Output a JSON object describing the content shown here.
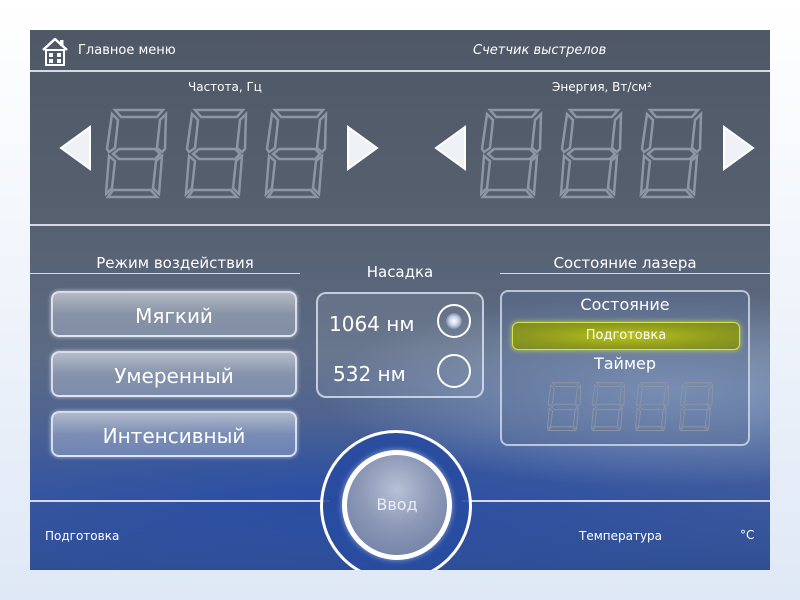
{
  "header": {
    "home_label": "Главное меню",
    "counter_label": "Счетчик выстрелов"
  },
  "frequency": {
    "label": "Частота, Гц"
  },
  "energy": {
    "label": "Энергия, Вт/см²"
  },
  "mode": {
    "title": "Режим воздействия",
    "buttons": [
      "Мягкий",
      "Умеренный",
      "Интенсивный"
    ]
  },
  "nozzle": {
    "title": "Насадка",
    "options": [
      "1064 нм",
      "532 нм"
    ],
    "selected": "1064 нм"
  },
  "laser": {
    "title": "Состояние лазера",
    "state_label": "Состояние",
    "state_value": "Подготовка",
    "state_color": "#b8c21a",
    "timer_label": "Таймер"
  },
  "enter_label": "Ввод",
  "footer": {
    "status": "Подготовка",
    "temperature_label": "Температура",
    "temperature_unit": "°C"
  },
  "icons": {
    "home": "home-icon",
    "left": "arrow-left-icon",
    "right": "arrow-right-icon"
  }
}
